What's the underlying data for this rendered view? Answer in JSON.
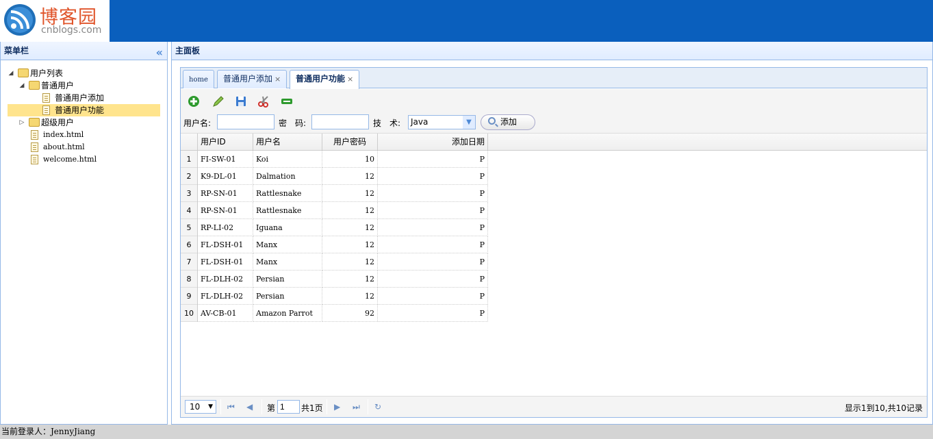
{
  "header": {
    "logo_name": "博客园",
    "logo_domain": "cnblogs.com"
  },
  "west": {
    "title": "菜单栏",
    "tree": [
      {
        "label": "用户列表",
        "type": "folder",
        "level": 0,
        "expanded": true
      },
      {
        "label": "普通用户",
        "type": "folder",
        "level": 1,
        "expanded": true
      },
      {
        "label": "普通用户添加",
        "type": "file",
        "level": 2
      },
      {
        "label": "普通用户功能",
        "type": "file",
        "level": 2,
        "selected": true
      },
      {
        "label": "超级用户",
        "type": "folder",
        "level": 1,
        "expanded": false
      },
      {
        "label": "index.html",
        "type": "file",
        "level": 1
      },
      {
        "label": "about.html",
        "type": "file",
        "level": 1
      },
      {
        "label": "welcome.html",
        "type": "file",
        "level": 1
      }
    ]
  },
  "center": {
    "title": "主面板",
    "tabs": [
      {
        "label": "home",
        "closable": false
      },
      {
        "label": "普通用户添加",
        "closable": true
      },
      {
        "label": "普通用户功能",
        "closable": true,
        "active": true
      }
    ],
    "toolbar_icons": [
      "add-icon",
      "edit-icon",
      "save-icon",
      "cut-icon",
      "remove-icon"
    ],
    "search": {
      "username_label": "用户名:",
      "username_value": "",
      "password_label": "密　码:",
      "password_value": "",
      "tech_label": "技　术:",
      "tech_value": "Java",
      "add_button": "添加"
    },
    "grid": {
      "columns": [
        "用户ID",
        "用户名",
        "用户密码",
        "添加日期"
      ],
      "rows": [
        [
          "1",
          "FI-SW-01",
          "Koi",
          "10",
          "P"
        ],
        [
          "2",
          "K9-DL-01",
          "Dalmation",
          "12",
          "P"
        ],
        [
          "3",
          "RP-SN-01",
          "Rattlesnake",
          "12",
          "P"
        ],
        [
          "4",
          "RP-SN-01",
          "Rattlesnake",
          "12",
          "P"
        ],
        [
          "5",
          "RP-LI-02",
          "Iguana",
          "12",
          "P"
        ],
        [
          "6",
          "FL-DSH-01",
          "Manx",
          "12",
          "P"
        ],
        [
          "7",
          "FL-DSH-01",
          "Manx",
          "12",
          "P"
        ],
        [
          "8",
          "FL-DLH-02",
          "Persian",
          "12",
          "P"
        ],
        [
          "9",
          "FL-DLH-02",
          "Persian",
          "12",
          "P"
        ],
        [
          "10",
          "AV-CB-01",
          "Amazon Parrot",
          "92",
          "P"
        ]
      ]
    },
    "pager": {
      "page_size": "10",
      "page_prefix": "第",
      "page_value": "1",
      "page_total": "共1页",
      "info": "显示1到10,共10记录"
    }
  },
  "status": {
    "text": "当前登录人：JennyJiang"
  },
  "colors": {
    "header_bg": "#0a5fbd",
    "border": "#95b8e7",
    "selected": "#ffe48d"
  }
}
